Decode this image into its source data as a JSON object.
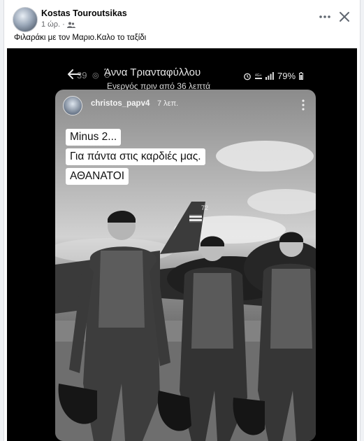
{
  "post": {
    "author": "Kostas Touroutsikas",
    "time": "1 ώρ.",
    "separator": "·",
    "text": "Φιλαράκι με τον Μαριο.Καλο το ταξίδι"
  },
  "icons": {
    "audience": "friends-icon",
    "more": "more-horizontal-icon",
    "close": "close-icon"
  },
  "chat_header": {
    "ghost_time": "39",
    "contact_name": "Άννα Τριανταφύλλου",
    "contact_status": "Ενεργός πριν από 36 λεπτά",
    "battery": "79%"
  },
  "story": {
    "username": "christos_papv4",
    "time": "7 λεπ.",
    "caption_lines": [
      "Minus 2...",
      "Για πάντα στις καρδιές μας.",
      "ΑΘΑΝΑΤΟΙ"
    ],
    "tail_number": "72"
  }
}
